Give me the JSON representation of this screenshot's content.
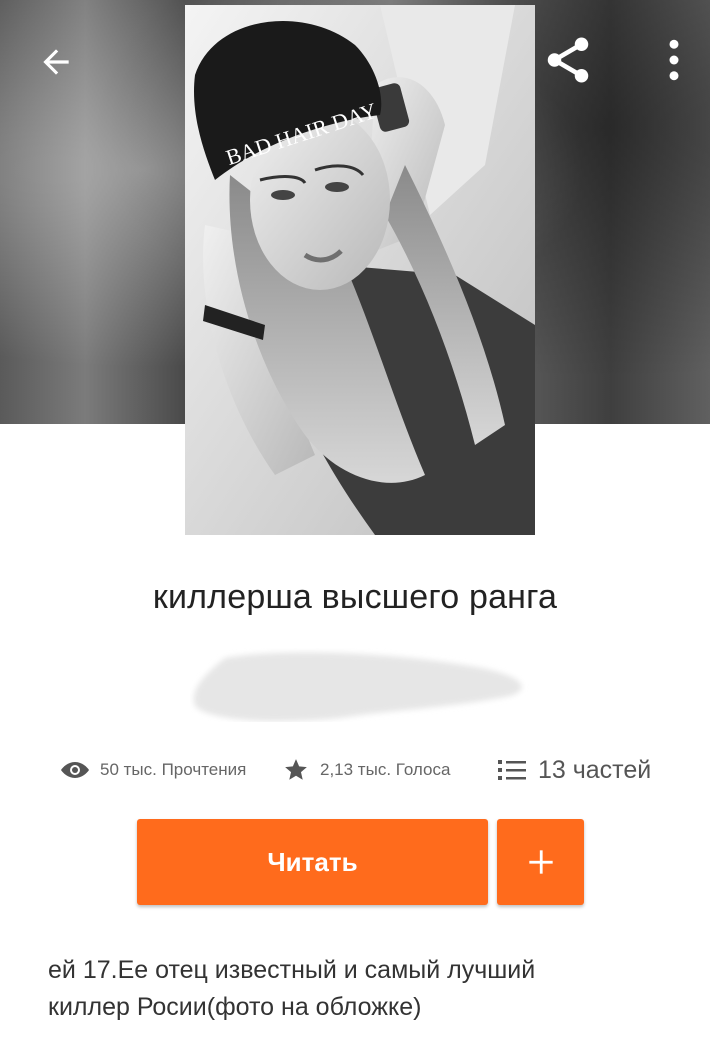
{
  "header": {
    "back_icon": "arrow-left-icon",
    "share_icon": "share-icon",
    "more_icon": "more-vertical-icon"
  },
  "cover": {
    "hat_text": "BAD HAIR DAY"
  },
  "story": {
    "title": "киллерша высшего ранга"
  },
  "stats": {
    "views": "50 тыс. Прочтения",
    "votes": "2,13 тыс. Голоса",
    "parts": "13 частей"
  },
  "actions": {
    "read_label": "Читать",
    "add_label": "+"
  },
  "description": {
    "line1": "ей 17.Ее отец известный и самый лучший",
    "line2": "киллер Росии(фото на обложке)"
  },
  "colors": {
    "accent": "#ff6b1c",
    "text": "#222222",
    "muted": "#666666"
  }
}
